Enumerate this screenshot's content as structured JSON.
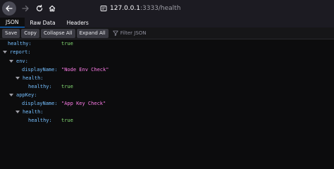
{
  "browser": {
    "url_host": "127.0.0.1",
    "url_rest": ":3333/health"
  },
  "tabs": [
    {
      "label": "JSON"
    },
    {
      "label": "Raw Data"
    },
    {
      "label": "Headers"
    }
  ],
  "toolbar": {
    "save_label": "Save",
    "copy_label": "Copy",
    "collapse_label": "Collapse All",
    "expand_label": "Expand All",
    "filter_placeholder": "Filter JSON"
  },
  "tree": {
    "healthy_key": "healthy:",
    "healthy_val": "true",
    "report_key": "report:",
    "env_key": "env:",
    "env_display_key": "displayName:",
    "env_display_val": "\"Node Env Check\"",
    "env_health_key": "health:",
    "env_healthy_key": "healthy:",
    "env_healthy_val": "true",
    "appkey_key": "appKey:",
    "appkey_display_key": "displayName:",
    "appkey_display_val": "\"App Key Check\"",
    "appkey_health_key": "health:",
    "appkey_healthy_key": "healthy:",
    "appkey_healthy_val": "true"
  },
  "colors": {
    "accent": "#0a84ff",
    "key": "#75bfff",
    "boolean": "#86de74",
    "string": "#ff7de9"
  }
}
